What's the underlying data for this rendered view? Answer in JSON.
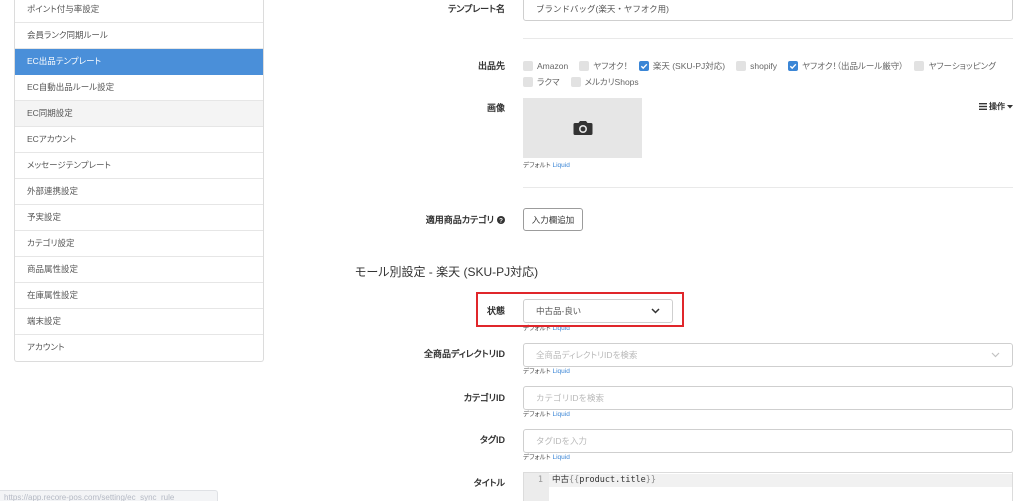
{
  "colors": {
    "accent": "#4a8fd9",
    "checkbox_checked": "#3b86d6",
    "link": "#3b86d6",
    "highlight": "#e0262b"
  },
  "status_bar": {
    "url": "https://app.recore-pos.com/setting/ec_sync_rule"
  },
  "sidebar": {
    "items": [
      {
        "label": "ポイント付与率設定"
      },
      {
        "label": "会員ランク同期ルール"
      },
      {
        "label": "EC出品テンプレート",
        "active": true
      },
      {
        "label": "EC自動出品ルール設定"
      },
      {
        "label": "EC同期設定",
        "hover": true
      },
      {
        "label": "ECアカウント"
      },
      {
        "label": "メッセージテンプレート"
      },
      {
        "label": "外部連携設定"
      },
      {
        "label": "予実設定"
      },
      {
        "label": "カテゴリ設定"
      },
      {
        "label": "商品属性設定"
      },
      {
        "label": "在庫属性設定"
      },
      {
        "label": "端末設定"
      },
      {
        "label": "アカウント"
      }
    ]
  },
  "helper": {
    "default_label": "デフォルト",
    "liquid_link": "Liquid"
  },
  "form": {
    "template_name": {
      "label": "テンプレート名",
      "value": "ブランドバッグ(楽天・ヤフオク用)"
    },
    "channels": {
      "label": "出品先",
      "options": [
        {
          "label": "Amazon",
          "checked": false
        },
        {
          "label": "ヤフオク！",
          "checked": false
        },
        {
          "label": "楽天 (SKU-PJ対応)",
          "checked": true
        },
        {
          "label": "shopify",
          "checked": false
        },
        {
          "label": "ヤフオク！（出品ルール厳守）",
          "checked": true
        },
        {
          "label": "ヤフーショッピング",
          "checked": false
        },
        {
          "label": "ラクマ",
          "checked": false
        },
        {
          "label": "メルカリShops",
          "checked": false
        }
      ]
    },
    "image": {
      "label": "画像",
      "actions_button": "操作",
      "placeholder_icon": "camera-icon"
    },
    "product_category": {
      "label": "適用商品カテゴリ",
      "help_icon": "question-circle-icon",
      "add_button": "入力欄追加"
    }
  },
  "mall_settings": {
    "heading": "モール別設定 - 楽天 (SKU-PJ対応)",
    "condition": {
      "label": "状態",
      "value": "中古品-良い"
    },
    "directory_id": {
      "label": "全商品ディレクトリID",
      "placeholder": "全商品ディレクトリIDを検索"
    },
    "category_id": {
      "label": "カテゴリID",
      "placeholder": "カテゴリIDを検索"
    },
    "tag_id": {
      "label": "タグID",
      "placeholder": "タグIDを入力"
    },
    "title": {
      "label": "タイトル",
      "lines": [
        {
          "number": "1",
          "tokens": [
            "中古",
            "{{",
            "product.title",
            "}}"
          ]
        }
      ]
    }
  }
}
